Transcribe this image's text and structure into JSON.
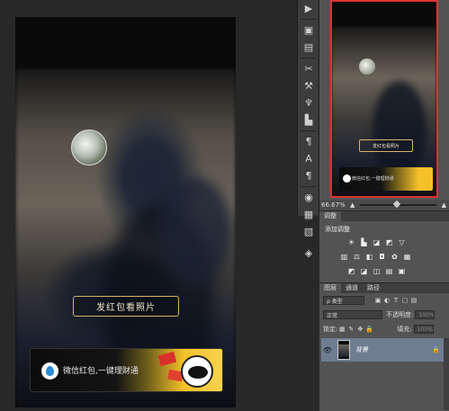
{
  "canvas": {
    "share_button_label": "发红包看照片",
    "ad_text": "微信红包,一键理财通"
  },
  "toolstrip": {
    "tools": [
      {
        "icon": "play-icon",
        "glyph": "▶"
      },
      {
        "icon": "navigator-icon",
        "glyph": "▣"
      },
      {
        "icon": "info-icon",
        "glyph": "▤"
      },
      {
        "icon": "brush-settings-icon",
        "glyph": "✂"
      },
      {
        "icon": "brush-presets-icon",
        "glyph": "⚒"
      },
      {
        "icon": "clone-source-icon",
        "glyph": "♆"
      },
      {
        "icon": "tool-presets-icon",
        "glyph": "▙"
      },
      {
        "icon": "paragraph-styles-icon",
        "glyph": "¶"
      },
      {
        "icon": "character-icon",
        "glyph": "A"
      },
      {
        "icon": "paragraph-icon",
        "glyph": "¶"
      },
      {
        "icon": "color-icon",
        "glyph": "◉"
      },
      {
        "icon": "swatches-icon",
        "glyph": "▦"
      },
      {
        "icon": "styles-icon",
        "glyph": "▧"
      },
      {
        "icon": "layers-icon",
        "glyph": "◈"
      }
    ]
  },
  "navigator": {
    "thumb_button_label": "发红包看照片",
    "thumb_ad_text": "微信红包,一键理财通",
    "zoom_value": "66.67%"
  },
  "adjustments": {
    "tab_label": "调整",
    "title": "添加调整"
  },
  "layers": {
    "tabs": [
      "图层",
      "通道",
      "路径"
    ],
    "filter_label": "ρ 类型",
    "blend_mode": "正常",
    "opacity_label": "不透明度:",
    "opacity_value": "100%",
    "lock_label": "锁定:",
    "fill_label": "填充:",
    "fill_value": "100%",
    "layer_name": "背景"
  }
}
